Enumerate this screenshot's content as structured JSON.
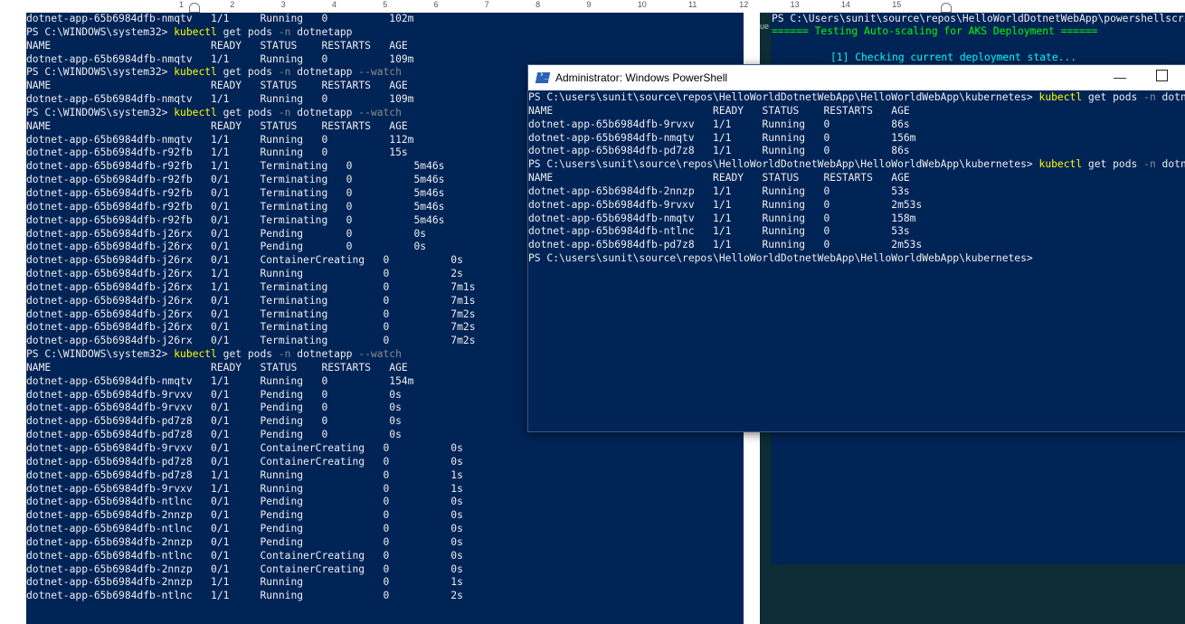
{
  "ruler": {
    "numbers": [
      "1",
      "2",
      "3",
      "4",
      "5",
      "6",
      "7",
      "8",
      "9",
      "10",
      "11",
      "12",
      "13",
      "14",
      "15"
    ]
  },
  "left_terminal": {
    "lines": [
      {
        "type": "text",
        "text": "dotnet-app-65b6984dfb-nmqtv   1/1     Running   0          102m"
      },
      {
        "type": "prompt",
        "ps": "PS C:\\WINDOWS\\system32> ",
        "cmd": "kubectl",
        "args": " get pods ",
        "flag": "-n",
        "rest": " dotnetapp"
      },
      {
        "type": "text",
        "text": "NAME                          READY   STATUS    RESTARTS   AGE"
      },
      {
        "type": "text",
        "text": "dotnet-app-65b6984dfb-nmqtv   1/1     Running   0          109m"
      },
      {
        "type": "prompt",
        "ps": "PS C:\\WINDOWS\\system32> ",
        "cmd": "kubectl",
        "args": " get pods ",
        "flag": "-n",
        "rest": " dotnetapp ",
        "flag2": "--watch"
      },
      {
        "type": "text",
        "text": "NAME                          READY   STATUS    RESTARTS   AGE"
      },
      {
        "type": "text",
        "text": "dotnet-app-65b6984dfb-nmqtv   1/1     Running   0          109m"
      },
      {
        "type": "prompt",
        "ps": "PS C:\\WINDOWS\\system32> ",
        "cmd": "kubectl",
        "args": " get pods ",
        "flag": "-n",
        "rest": " dotnetapp ",
        "flag2": "--watch"
      },
      {
        "type": "text",
        "text": "NAME                          READY   STATUS    RESTARTS   AGE"
      },
      {
        "type": "text",
        "text": "dotnet-app-65b6984dfb-nmqtv   1/1     Running   0          112m"
      },
      {
        "type": "text",
        "text": "dotnet-app-65b6984dfb-r92fb   1/1     Running   0          15s"
      },
      {
        "type": "text",
        "text": "dotnet-app-65b6984dfb-r92fb   1/1     Terminating   0          5m46s"
      },
      {
        "type": "text",
        "text": "dotnet-app-65b6984dfb-r92fb   0/1     Terminating   0          5m46s"
      },
      {
        "type": "text",
        "text": "dotnet-app-65b6984dfb-r92fb   0/1     Terminating   0          5m46s"
      },
      {
        "type": "text",
        "text": "dotnet-app-65b6984dfb-r92fb   0/1     Terminating   0          5m46s"
      },
      {
        "type": "text",
        "text": "dotnet-app-65b6984dfb-r92fb   0/1     Terminating   0          5m46s"
      },
      {
        "type": "text",
        "text": "dotnet-app-65b6984dfb-j26rx   0/1     Pending       0          0s"
      },
      {
        "type": "text",
        "text": "dotnet-app-65b6984dfb-j26rx   0/1     Pending       0          0s"
      },
      {
        "type": "text",
        "text": "dotnet-app-65b6984dfb-j26rx   0/1     ContainerCreating   0          0s"
      },
      {
        "type": "text",
        "text": "dotnet-app-65b6984dfb-j26rx   1/1     Running             0          2s"
      },
      {
        "type": "text",
        "text": "dotnet-app-65b6984dfb-j26rx   1/1     Terminating         0          7m1s"
      },
      {
        "type": "text",
        "text": "dotnet-app-65b6984dfb-j26rx   0/1     Terminating         0          7m1s"
      },
      {
        "type": "text",
        "text": "dotnet-app-65b6984dfb-j26rx   0/1     Terminating         0          7m2s"
      },
      {
        "type": "text",
        "text": "dotnet-app-65b6984dfb-j26rx   0/1     Terminating         0          7m2s"
      },
      {
        "type": "text",
        "text": "dotnet-app-65b6984dfb-j26rx   0/1     Terminating         0          7m2s"
      },
      {
        "type": "prompt",
        "ps": "PS C:\\WINDOWS\\system32> ",
        "cmd": "kubectl",
        "args": " get pods ",
        "flag": "-n",
        "rest": " dotnetapp ",
        "flag2": "--watch"
      },
      {
        "type": "text",
        "text": "NAME                          READY   STATUS    RESTARTS   AGE"
      },
      {
        "type": "text",
        "text": "dotnet-app-65b6984dfb-nmqtv   1/1     Running   0          154m"
      },
      {
        "type": "text",
        "text": "dotnet-app-65b6984dfb-9rvxv   0/1     Pending   0          0s"
      },
      {
        "type": "text",
        "text": "dotnet-app-65b6984dfb-9rvxv   0/1     Pending   0          0s"
      },
      {
        "type": "text",
        "text": "dotnet-app-65b6984dfb-pd7z8   0/1     Pending   0          0s"
      },
      {
        "type": "text",
        "text": "dotnet-app-65b6984dfb-pd7z8   0/1     Pending   0          0s"
      },
      {
        "type": "text",
        "text": "dotnet-app-65b6984dfb-9rvxv   0/1     ContainerCreating   0          0s"
      },
      {
        "type": "text",
        "text": "dotnet-app-65b6984dfb-pd7z8   0/1     ContainerCreating   0          0s"
      },
      {
        "type": "text",
        "text": "dotnet-app-65b6984dfb-pd7z8   1/1     Running             0          1s"
      },
      {
        "type": "text",
        "text": "dotnet-app-65b6984dfb-9rvxv   1/1     Running             0          1s"
      },
      {
        "type": "text",
        "text": "dotnet-app-65b6984dfb-ntlnc   0/1     Pending             0          0s"
      },
      {
        "type": "text",
        "text": "dotnet-app-65b6984dfb-2nnzp   0/1     Pending             0          0s"
      },
      {
        "type": "text",
        "text": "dotnet-app-65b6984dfb-ntlnc   0/1     Pending             0          0s"
      },
      {
        "type": "text",
        "text": "dotnet-app-65b6984dfb-2nnzp   0/1     Pending             0          0s"
      },
      {
        "type": "text",
        "text": "dotnet-app-65b6984dfb-ntlnc   0/1     ContainerCreating   0          0s"
      },
      {
        "type": "text",
        "text": "dotnet-app-65b6984dfb-2nnzp   0/1     ContainerCreating   0          0s"
      },
      {
        "type": "text",
        "text": "dotnet-app-65b6984dfb-2nnzp   1/1     Running             0          1s"
      },
      {
        "type": "text",
        "text": "dotnet-app-65b6984dfb-ntlnc   1/1     Running             0          2s"
      }
    ]
  },
  "background_window": {
    "ue_label": "ue",
    "top_line": "PS C:\\Users\\sunit\\source\\repos\\HelloWorldDotnetWebApp\\powershellscript",
    "subtitle": "====== Testing Auto-scaling for AKS Deployment ======",
    "check_line": "[1] Checking current deployment state..."
  },
  "ps_window": {
    "title": "Administrator: Windows PowerShell",
    "min_glyph": "—",
    "lines": [
      {
        "type": "prompt",
        "ps": "PS C:\\users\\sunit\\source\\repos\\HelloWorldDotnetWebApp\\HelloWorldWebApp\\kubernetes> ",
        "cmd": "kubectl",
        "args": " get pods ",
        "flag": "-n",
        "rest": " dotneta"
      },
      {
        "type": "text",
        "text": "NAME                          READY   STATUS    RESTARTS   AGE"
      },
      {
        "type": "text",
        "text": "dotnet-app-65b6984dfb-9rvxv   1/1     Running   0          86s"
      },
      {
        "type": "text",
        "text": "dotnet-app-65b6984dfb-nmqtv   1/1     Running   0          156m"
      },
      {
        "type": "text",
        "text": "dotnet-app-65b6984dfb-pd7z8   1/1     Running   0          86s"
      },
      {
        "type": "prompt",
        "ps": "PS C:\\users\\sunit\\source\\repos\\HelloWorldDotnetWebApp\\HelloWorldWebApp\\kubernetes> ",
        "cmd": "kubectl",
        "args": " get pods ",
        "flag": "-n",
        "rest": " dotneta"
      },
      {
        "type": "text",
        "text": "NAME                          READY   STATUS    RESTARTS   AGE"
      },
      {
        "type": "text",
        "text": "dotnet-app-65b6984dfb-2nnzp   1/1     Running   0          53s"
      },
      {
        "type": "text",
        "text": "dotnet-app-65b6984dfb-9rvxv   1/1     Running   0          2m53s"
      },
      {
        "type": "text",
        "text": "dotnet-app-65b6984dfb-nmqtv   1/1     Running   0          158m"
      },
      {
        "type": "text",
        "text": "dotnet-app-65b6984dfb-ntlnc   1/1     Running   0          53s"
      },
      {
        "type": "text",
        "text": "dotnet-app-65b6984dfb-pd7z8   1/1     Running   0          2m53s"
      },
      {
        "type": "text",
        "text": "PS C:\\users\\sunit\\source\\repos\\HelloWorldDotnetWebApp\\HelloWorldWebApp\\kubernetes>"
      }
    ]
  },
  "colors": {
    "ps_background": "#012456",
    "ps_text": "#eeedf0",
    "command": "#ffff00",
    "flag": "#8a8a8a",
    "banner_green": "#00ff00",
    "info_cyan": "#00ffff"
  }
}
